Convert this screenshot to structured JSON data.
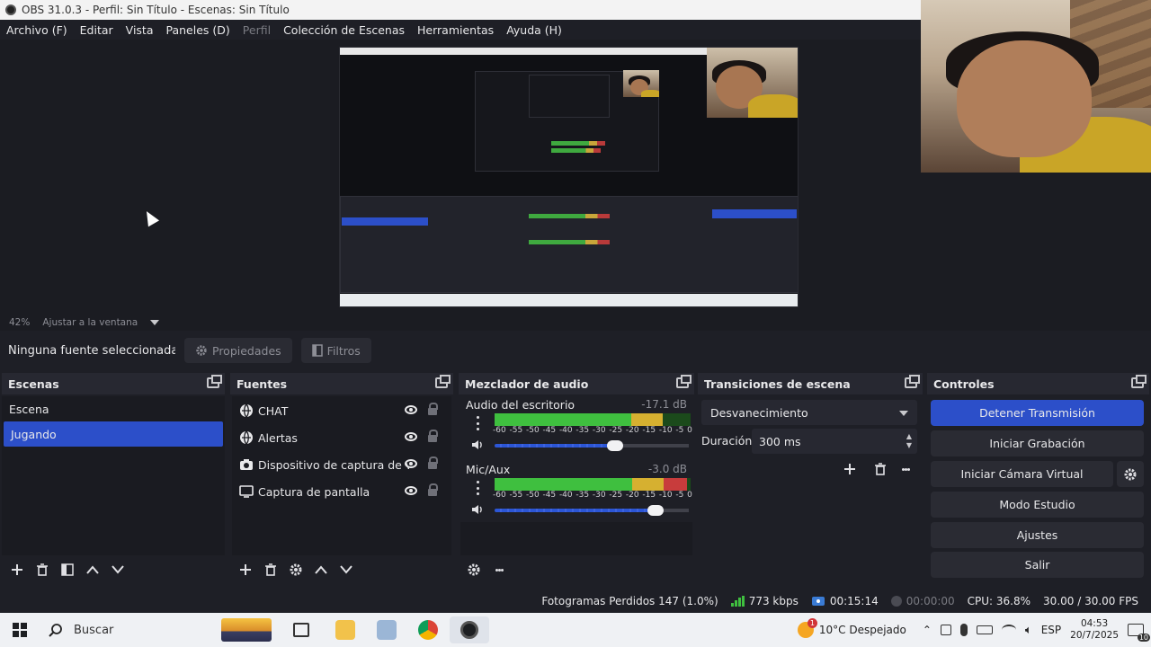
{
  "window": {
    "title": "OBS 31.0.3 - Perfil: Sin Título - Escenas: Sin Título"
  },
  "menu": [
    {
      "label": "Archivo (F)",
      "disabled": false
    },
    {
      "label": "Editar",
      "disabled": false
    },
    {
      "label": "Vista",
      "disabled": false
    },
    {
      "label": "Paneles (D)",
      "disabled": false
    },
    {
      "label": "Perfil",
      "disabled": true
    },
    {
      "label": "Colección de Escenas",
      "disabled": false
    },
    {
      "label": "Herramientas",
      "disabled": false
    },
    {
      "label": "Ayuda (H)",
      "disabled": false
    }
  ],
  "preview": {
    "zoom": "42%",
    "fit_label": "Ajustar a la ventana"
  },
  "source_toolbar": {
    "no_selection": "Ninguna fuente seleccionada",
    "properties": "Propiedades",
    "filters": "Filtros"
  },
  "scenes": {
    "title": "Escenas",
    "items": [
      {
        "label": "Escena",
        "active": false
      },
      {
        "label": "Jugando",
        "active": true
      }
    ]
  },
  "sources": {
    "title": "Fuentes",
    "items": [
      {
        "label": "CHAT",
        "icon": "browser-icon"
      },
      {
        "label": "Alertas",
        "icon": "browser-icon"
      },
      {
        "label": "Dispositivo de captura de video",
        "icon": "camera-icon"
      },
      {
        "label": "Captura de pantalla",
        "icon": "monitor-icon"
      }
    ]
  },
  "mixer": {
    "title": "Mezclador de audio",
    "scale": [
      "-60",
      "-55",
      "-50",
      "-45",
      "-40",
      "-35",
      "-30",
      "-25",
      "-20",
      "-15",
      "-10",
      "-5",
      "0"
    ],
    "channels": [
      {
        "name": "Audio del escritorio",
        "db": "-17.1 dB",
        "level": 0.86,
        "volume": 0.62
      },
      {
        "name": "Mic/Aux",
        "db": "-3.0 dB",
        "level": 0.98,
        "volume": 0.83
      }
    ]
  },
  "transitions": {
    "title": "Transiciones de escena",
    "selected": "Desvanecimiento",
    "duration_label": "Duración",
    "duration_value": "300 ms"
  },
  "controls": {
    "title": "Controles",
    "stop_stream": "Detener Transmisión",
    "start_recording": "Iniciar Grabación",
    "start_virtual_cam": "Iniciar Cámara Virtual",
    "studio_mode": "Modo Estudio",
    "settings": "Ajustes",
    "exit": "Salir"
  },
  "status": {
    "dropped_frames": "Fotogramas Perdidos 147 (1.0%)",
    "bitrate": "773 kbps",
    "stream_time": "00:15:14",
    "rec_time": "00:00:00",
    "cpu": "CPU: 36.8%",
    "fps": "30.00 / 30.00 FPS"
  },
  "taskbar": {
    "search_placeholder": "Buscar",
    "weather": "10°C  Despejado",
    "language": "ESP",
    "time": "04:53",
    "date": "20/7/2025",
    "notification_count": "10",
    "weather_badge": "1"
  },
  "colors": {
    "accent": "#2c4fc9",
    "background": "#1e1f26",
    "meter_green": "#3fbf3f",
    "meter_yellow": "#d6b030",
    "meter_red": "#c83c3c"
  }
}
